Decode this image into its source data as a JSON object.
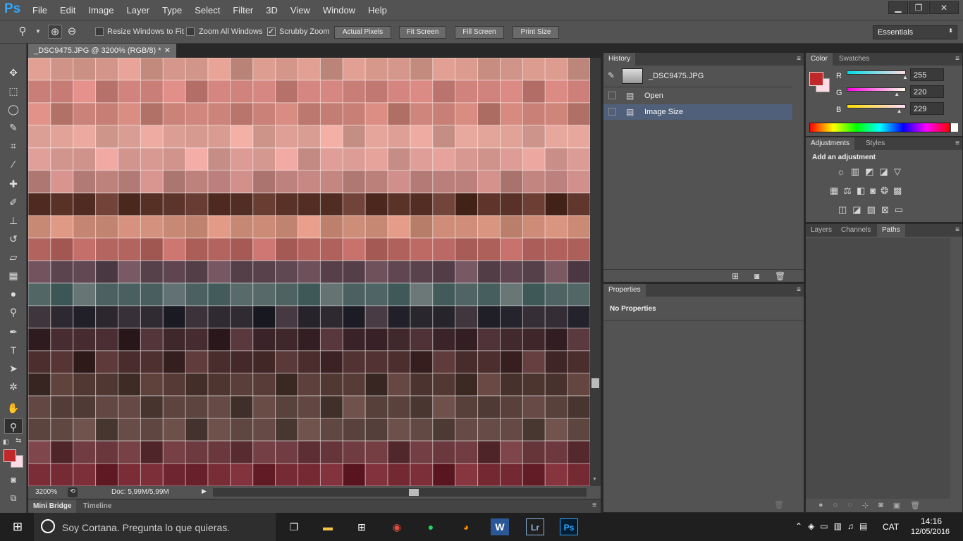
{
  "app": {
    "logo": "Ps",
    "menus": [
      "File",
      "Edit",
      "Image",
      "Layer",
      "Type",
      "Select",
      "Filter",
      "3D",
      "View",
      "Window",
      "Help"
    ],
    "window_controls": {
      "minimize": "▁",
      "restore": "❐",
      "close": "✕"
    }
  },
  "options_bar": {
    "resize_windows_label": "Resize Windows to Fit",
    "resize_windows_checked": false,
    "zoom_all_label": "Zoom All Windows",
    "zoom_all_checked": false,
    "scrubby_zoom_label": "Scrubby Zoom",
    "scrubby_zoom_checked": true,
    "buttons": [
      "Actual Pixels",
      "Fit Screen",
      "Fill Screen",
      "Print Size"
    ],
    "workspace": "Essentials"
  },
  "document": {
    "tab_title": "_DSC9475.JPG @ 3200% (RGB/8) *",
    "zoom": "3200%",
    "doc_info": "Doc: 5,99M/5,99M"
  },
  "history_panel": {
    "tab": "History",
    "snapshot_name": "_DSC9475.JPG",
    "items": [
      {
        "label": "Open",
        "selected": false
      },
      {
        "label": "Image Size",
        "selected": true
      }
    ]
  },
  "properties_panel": {
    "tab": "Properties",
    "content": "No Properties"
  },
  "color_panel": {
    "tabs": [
      "Color",
      "Swatches"
    ],
    "foreground": "#c0282a",
    "background": "#ffdce5",
    "channels": [
      {
        "label": "R",
        "value": "255",
        "value_pct": 100
      },
      {
        "label": "G",
        "value": "220",
        "value_pct": 86
      },
      {
        "label": "B",
        "value": "229",
        "value_pct": 90
      }
    ]
  },
  "adjustments_panel": {
    "tabs": [
      "Adjustments",
      "Styles"
    ],
    "heading": "Add an adjustment"
  },
  "layers_panel": {
    "tabs": [
      "Layers",
      "Channels",
      "Paths"
    ],
    "active_tab": "Paths"
  },
  "bottom_tabs": [
    "Mini Bridge",
    "Timeline"
  ],
  "taskbar": {
    "search_placeholder": "Soy Cortana. Pregunta lo que quieras.",
    "language": "CAT",
    "time": "14:16",
    "date": "12/05/2016"
  },
  "colors": {
    "ui_dark": "#535353",
    "ui_darker": "#3f3f3f",
    "selected_row": "#51607a",
    "photoshop_blue": "#31a8ff"
  }
}
